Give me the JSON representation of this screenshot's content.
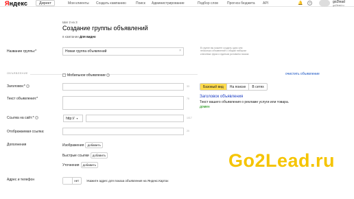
{
  "header": {
    "logo_text": "Яндекс",
    "section_label": "Директ",
    "nav": [
      "Мои клиенты",
      "Создать кампанию",
      "Поиск",
      "Администрирование",
      "Подбор слов",
      "Прогноз бюджета",
      "API"
    ],
    "user_name": "go2lead",
    "user_sub": "go2lead.ru"
  },
  "page": {
    "step": "Шаг 2 из 3",
    "title": "Создание группы объявлений",
    "campaign_prefix": "в кампании",
    "campaign_name": "Для видео"
  },
  "group_name": {
    "label": "Название группы:*",
    "value": "Новая группа объявлений",
    "hint": "В группе вы можете создать одно или несколько объявлений с общим набором ключевых фраз и единым условием показа"
  },
  "ads": {
    "section_title": "ОБЪЯВЛЕНИЕ",
    "mobile_label": "Мобильное объявление",
    "clear_link": "очистить объявление",
    "title_label": "Заголовок:*",
    "title_counter": "33",
    "text_label": "Текст объявления:*",
    "text_counter": "75",
    "link_label": "Ссылка на сайт:*",
    "link_protocol": "http://",
    "link_counter": "1017",
    "display_link_label": "Отображаемая ссылка:",
    "display_link_counter": "20",
    "extras_label": "Дополнения",
    "images_label": "Изображения",
    "sitelinks_label": "Быстрые ссылки",
    "callouts_label": "Уточнения",
    "add_label": "добавить",
    "address_label": "Адрес и телефон",
    "toggle_off": "",
    "toggle_on": "нет",
    "address_hint": "Укажите адрес для показа объявления на Яндекс.Картах"
  },
  "preview": {
    "tabs": [
      "Базовый вид",
      "На поиске",
      "В сетях"
    ],
    "title": "Заголовок объявления",
    "text": "Текст вашего объявления о рекламе услуги или товара.",
    "domain": "домен"
  },
  "watermark": "Go2Lead.ru",
  "colors": {
    "accent": "#ffdb4d",
    "link": "#1a55c3",
    "watermark": "#f5c400",
    "domain": "#0a8a00"
  }
}
